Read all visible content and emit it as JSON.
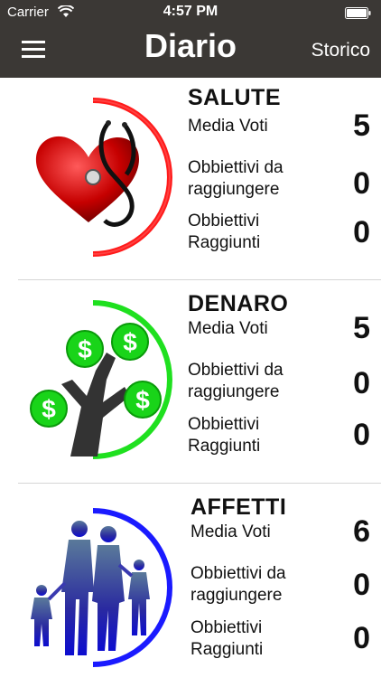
{
  "status_bar": {
    "carrier": "Carrier",
    "time": "4:57 PM"
  },
  "nav": {
    "title": "Diario",
    "right_button": "Storico",
    "menu_icon": "hamburger-menu-icon"
  },
  "sections": [
    {
      "title": "SALUTE",
      "icon": "heart-stethoscope-icon",
      "ring_color": "#ff1a1a",
      "rows": [
        {
          "label": "Media Voti",
          "value": "5"
        },
        {
          "label": "Obbiettivi da raggiungere",
          "value": "0"
        },
        {
          "label": "Obbiettivi Raggiunti",
          "value": "0"
        }
      ]
    },
    {
      "title": "DENARO",
      "icon": "money-tree-icon",
      "ring_color": "#1fe01f",
      "rows": [
        {
          "label": "Media Voti",
          "value": "5"
        },
        {
          "label": "Obbiettivi da raggiungere",
          "value": "0"
        },
        {
          "label": "Obbiettivi Raggiunti",
          "value": "0"
        }
      ]
    },
    {
      "title": "AFFETTI",
      "icon": "family-icon",
      "ring_color": "#1a1aff",
      "rows": [
        {
          "label": "Media Voti",
          "value": "6"
        },
        {
          "label": "Obbiettivi da raggiungere",
          "value": "0"
        },
        {
          "label": "Obbiettivi Raggiunti",
          "value": "0"
        }
      ]
    }
  ]
}
